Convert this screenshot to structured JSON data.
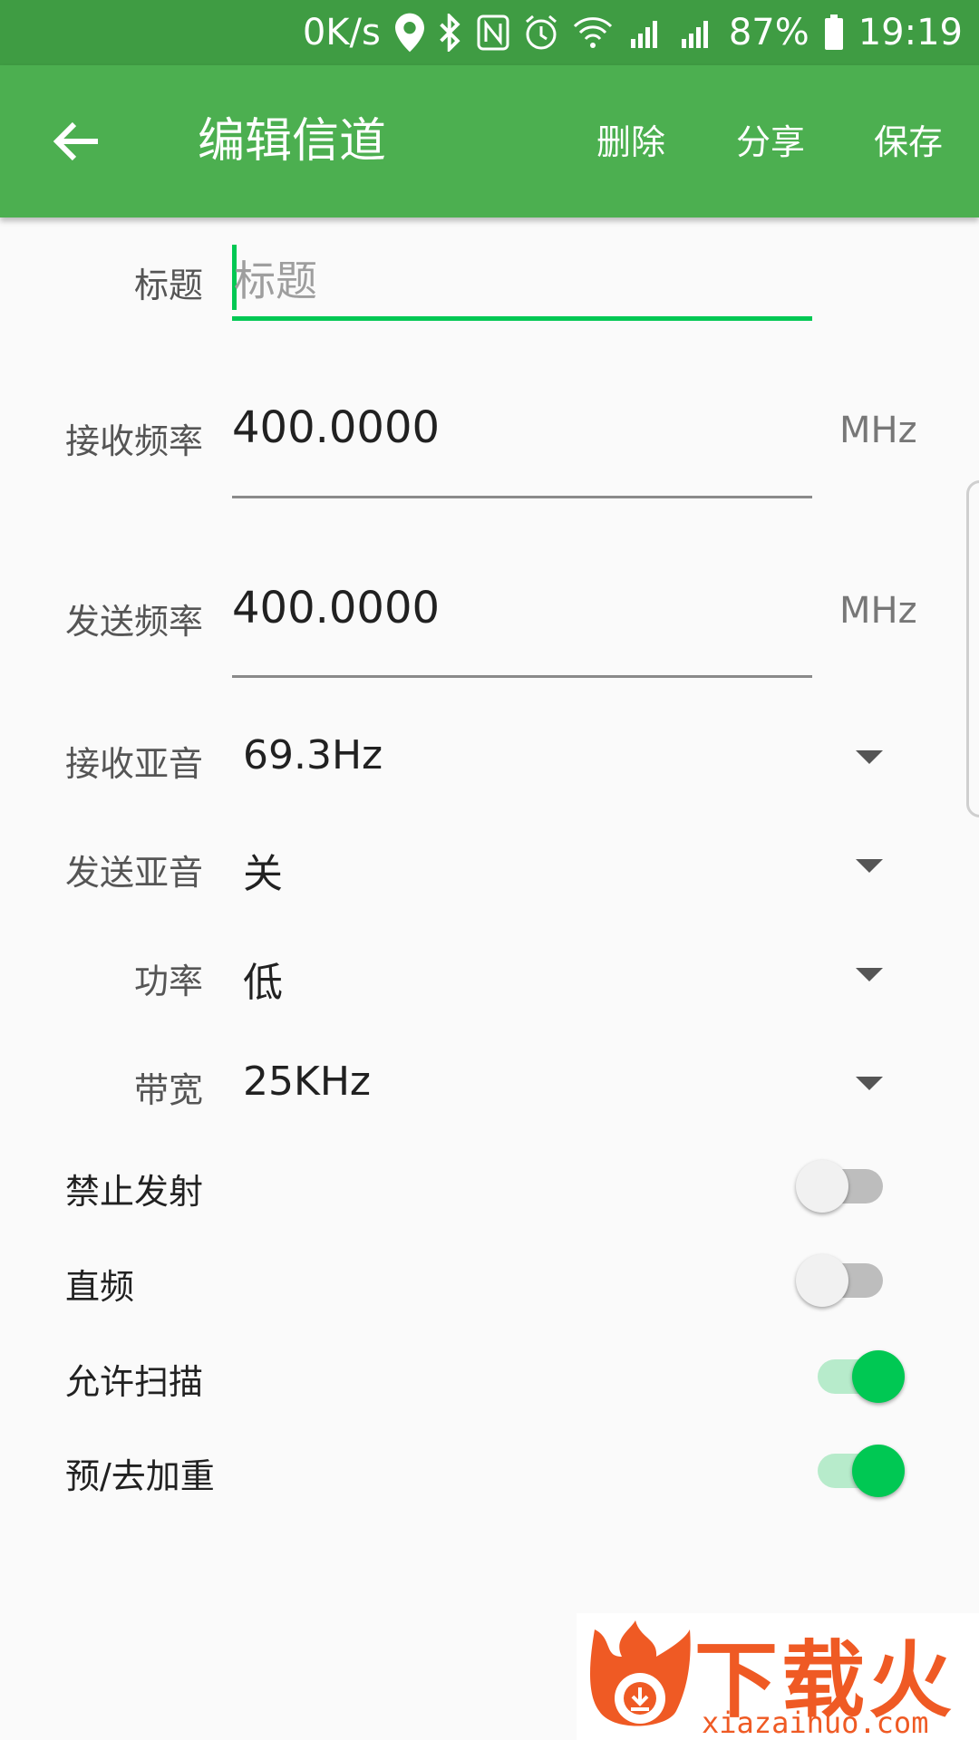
{
  "status_bar": {
    "speed": "0K/s",
    "battery": "87%",
    "time": "19:19",
    "icons": [
      "location-icon",
      "bluetooth-icon",
      "nfc-icon",
      "alarm-icon",
      "wifi-icon",
      "signal-4g-icon",
      "signal-e-icon",
      "battery-icon"
    ]
  },
  "toolbar": {
    "title": "编辑信道",
    "delete": "删除",
    "share": "分享",
    "save": "保存"
  },
  "form": {
    "title_label": "标题",
    "title_placeholder": "标题",
    "rx_freq_label": "接收频率",
    "rx_freq_value": "400.0000",
    "rx_freq_unit": "MHz",
    "tx_freq_label": "发送频率",
    "tx_freq_value": "400.0000",
    "tx_freq_unit": "MHz",
    "rx_tone_label": "接收亚音",
    "rx_tone_value": "69.3Hz",
    "tx_tone_label": "发送亚音",
    "tx_tone_value": "关",
    "power_label": "功率",
    "power_value": "低",
    "bandwidth_label": "带宽",
    "bandwidth_value": "25KHz"
  },
  "switches": [
    {
      "label": "禁止发射",
      "on": false
    },
    {
      "label": "直频",
      "on": false
    },
    {
      "label": "允许扫描",
      "on": true
    },
    {
      "label": "预/去加重",
      "on": true
    }
  ],
  "watermark": {
    "text": "下载火",
    "url": "xiazaihuo.com"
  },
  "colors": {
    "status_bar": "#3f9c43",
    "toolbar": "#4caf50",
    "accent": "#00c853"
  }
}
